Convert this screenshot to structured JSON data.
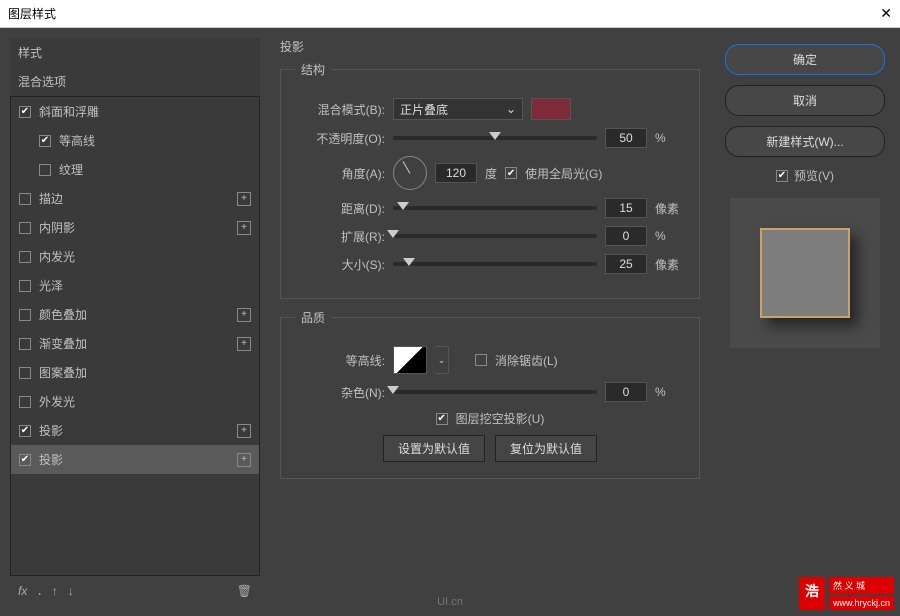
{
  "window": {
    "title": "图层样式",
    "close": "✕"
  },
  "sidebar": {
    "styles_label": "样式",
    "blend_label": "混合选项",
    "items": [
      {
        "label": "斜面和浮雕",
        "checked": true,
        "add": false,
        "indent": 0
      },
      {
        "label": "等高线",
        "checked": true,
        "add": false,
        "indent": 1
      },
      {
        "label": "纹理",
        "checked": false,
        "add": false,
        "indent": 1
      },
      {
        "label": "描边",
        "checked": false,
        "add": true,
        "indent": 0
      },
      {
        "label": "内阴影",
        "checked": false,
        "add": true,
        "indent": 0
      },
      {
        "label": "内发光",
        "checked": false,
        "add": false,
        "indent": 0
      },
      {
        "label": "光泽",
        "checked": false,
        "add": false,
        "indent": 0
      },
      {
        "label": "颜色叠加",
        "checked": false,
        "add": true,
        "indent": 0
      },
      {
        "label": "渐变叠加",
        "checked": false,
        "add": true,
        "indent": 0
      },
      {
        "label": "图案叠加",
        "checked": false,
        "add": false,
        "indent": 0
      },
      {
        "label": "外发光",
        "checked": false,
        "add": false,
        "indent": 0
      },
      {
        "label": "投影",
        "checked": true,
        "add": true,
        "indent": 0
      },
      {
        "label": "投影",
        "checked": true,
        "add": true,
        "indent": 0,
        "selected": true
      }
    ],
    "fx": "fx"
  },
  "center": {
    "title": "投影",
    "structure_legend": "结构",
    "quality_legend": "品质",
    "blend_mode_label": "混合模式(B):",
    "blend_mode_value": "正片叠底",
    "color": "#7f2a3a",
    "opacity_label": "不透明度(O):",
    "opacity_value": "50",
    "opacity_unit": "%",
    "angle_label": "角度(A):",
    "angle_value": "120",
    "angle_unit": "度",
    "global_light_label": "使用全局光(G)",
    "distance_label": "距离(D):",
    "distance_value": "15",
    "distance_unit": "像素",
    "spread_label": "扩展(R):",
    "spread_value": "0",
    "spread_unit": "%",
    "size_label": "大小(S):",
    "size_value": "25",
    "size_unit": "像素",
    "contour_label": "等高线:",
    "antialias_label": "消除锯齿(L)",
    "noise_label": "杂色(N):",
    "noise_value": "0",
    "noise_unit": "%",
    "knockout_label": "图层挖空投影(U)",
    "set_default": "设置为默认值",
    "reset_default": "复位为默认值"
  },
  "right": {
    "ok": "确定",
    "cancel": "取消",
    "new_style": "新建样式(W)...",
    "preview": "预览(V)"
  },
  "watermark": {
    "big": "浩",
    "small1": "然 义 城",
    "small2": "www.hryckj.cn"
  },
  "ui_logo": "UI.cn"
}
